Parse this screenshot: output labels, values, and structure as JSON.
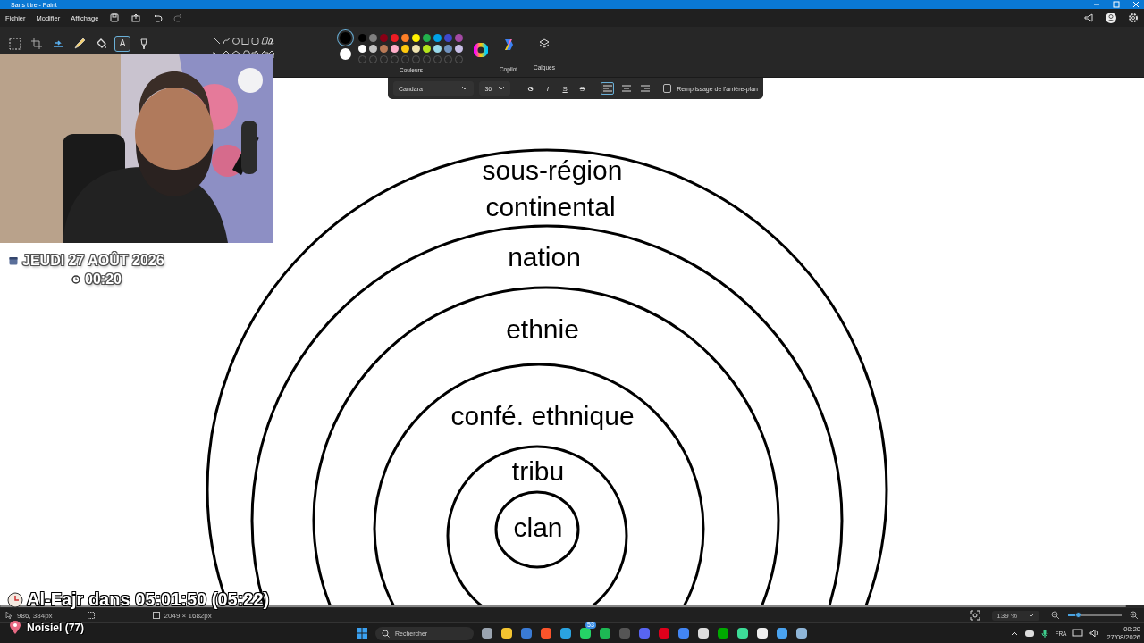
{
  "window": {
    "title": "Sans titre - Paint"
  },
  "menu": [
    "Fichier",
    "Modifier",
    "Affichage"
  ],
  "ribbon": {
    "tools": [
      {
        "kind": "select",
        "selected": false
      },
      {
        "kind": "crop",
        "selected": false
      },
      {
        "kind": "rotate",
        "selected": false
      },
      {
        "kind": "pencil",
        "selected": false
      },
      {
        "kind": "fill",
        "selected": false
      },
      {
        "kind": "text",
        "selected": true,
        "label": "A"
      },
      {
        "kind": "brush",
        "selected": false
      }
    ],
    "current_colors": [
      {
        "color": "#000000",
        "selected": true
      },
      {
        "color": "#ffffff",
        "selected": false
      }
    ],
    "palette": [
      {
        "color": "#000000"
      },
      {
        "color": "#7f7f7f"
      },
      {
        "color": "#880015"
      },
      {
        "color": "#ed1c24"
      },
      {
        "color": "#ff7f27"
      },
      {
        "color": "#fff200"
      },
      {
        "color": "#22b14c"
      },
      {
        "color": "#00a2e8"
      },
      {
        "color": "#3f48cc"
      },
      {
        "color": "#a349a4"
      },
      {
        "color": "#ffffff"
      },
      {
        "color": "#c3c3c3"
      },
      {
        "color": "#b97a57"
      },
      {
        "color": "#ffaec9"
      },
      {
        "color": "#ffc90e"
      },
      {
        "color": "#efe4b0"
      },
      {
        "color": "#b5e61d"
      },
      {
        "color": "#99d9ea"
      },
      {
        "color": "#7092be"
      },
      {
        "color": "#c8bfe7"
      }
    ],
    "colors_label": "Couleurs",
    "copilot_label": "Copilot",
    "layers_label": "Calques"
  },
  "text_toolbar": {
    "font": "Candara",
    "size": "36",
    "styles": [
      {
        "kind": "bold",
        "label": "G"
      },
      {
        "kind": "italic",
        "label": "I"
      },
      {
        "kind": "underline",
        "label": "S"
      },
      {
        "kind": "strike",
        "label": "S"
      }
    ],
    "align": [
      {
        "kind": "left",
        "selected": true
      },
      {
        "kind": "center",
        "selected": false
      },
      {
        "kind": "right",
        "selected": false
      }
    ],
    "background_fill": {
      "label": "Remplissage de l'arrière-plan",
      "checked": false
    }
  },
  "canvas": {
    "labels": [
      "sous-région",
      "continental",
      "nation",
      "ethnie",
      "confé. ethnique",
      "tribu",
      "clan"
    ]
  },
  "overlay": {
    "date": "JEUDI 27 AOÛT 2026",
    "time": "00:20",
    "prayer": "Al-Fajr dans 05:01:50 (05:22)",
    "location": "Noisiel (77)"
  },
  "status_bar": {
    "cursor": "986, 384px",
    "canvas_size": "2049 × 1682px",
    "zoom": "139 %",
    "zoom_level": {
      "level": 0.18
    }
  },
  "taskbar": {
    "search_placeholder": "Rechercher",
    "badge": "53",
    "language": "FRA",
    "time": "00:20",
    "date": "27/08/2026"
  }
}
